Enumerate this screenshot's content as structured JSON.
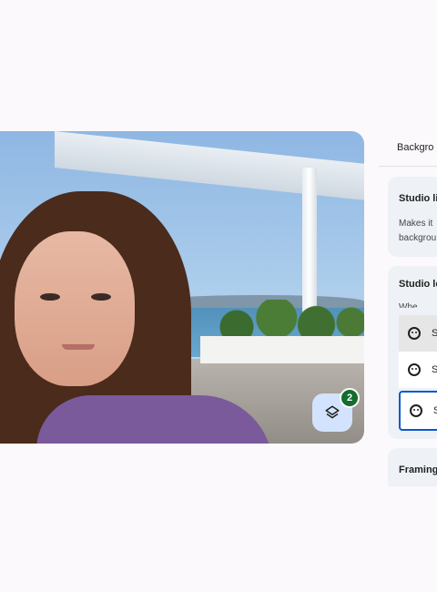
{
  "video": {
    "effects_badge_count": "2"
  },
  "panel": {
    "title": "Backgro",
    "cards": [
      {
        "title": "Studio li",
        "text_line1": "Makes it",
        "text_line2": "backgrou"
      },
      {
        "title": "Studio lo",
        "text_line1": "Whe"
      },
      {
        "title": "Framing"
      }
    ],
    "options": [
      {
        "label": "S",
        "icon": "face-icon"
      },
      {
        "label": "S",
        "icon": "face-sparkle-icon"
      },
      {
        "label": "S",
        "icon": "face-icon"
      }
    ]
  },
  "colors": {
    "accent": "#0b57d0",
    "badge": "#146c2e",
    "effects_button": "#d3e3fd"
  }
}
